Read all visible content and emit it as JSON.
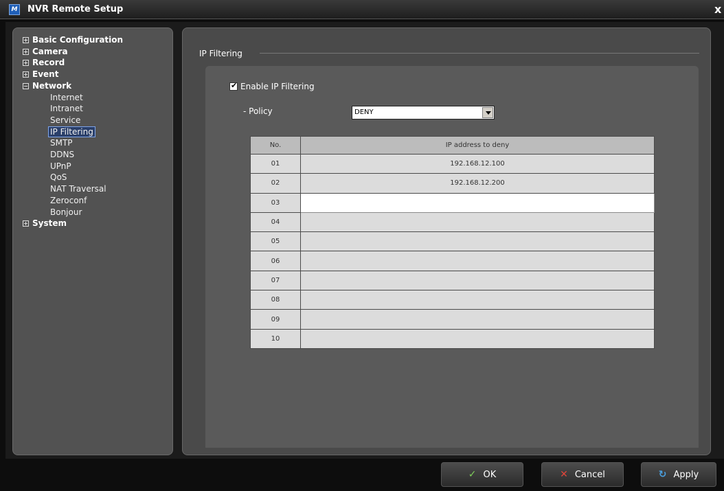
{
  "window": {
    "title": "NVR Remote Setup",
    "icon_label": "M",
    "close_glyph": "x"
  },
  "nav": {
    "top_items": [
      {
        "label": "Basic Configuration",
        "expanded": false
      },
      {
        "label": "Camera",
        "expanded": false
      },
      {
        "label": "Record",
        "expanded": false
      },
      {
        "label": "Event",
        "expanded": false
      },
      {
        "label": "Network",
        "expanded": true
      },
      {
        "label": "System",
        "expanded": false
      }
    ],
    "network_children": [
      "Internet",
      "Intranet",
      "Service",
      "IP Filtering",
      "SMTP",
      "DDNS",
      "UPnP",
      "QoS",
      "NAT Traversal",
      "Zeroconf",
      "Bonjour"
    ],
    "selected": "IP Filtering"
  },
  "section": {
    "title": "IP Filtering"
  },
  "form": {
    "enable_label": "Enable IP Filtering",
    "enable_checked": true,
    "policy_label": "- Policy",
    "policy_value": "DENY"
  },
  "table": {
    "headers": [
      "No.",
      "IP address to deny"
    ],
    "rows": [
      {
        "no": "01",
        "ip": "192.168.12.100"
      },
      {
        "no": "02",
        "ip": "192.168.12.200"
      },
      {
        "no": "03",
        "ip": ""
      },
      {
        "no": "04",
        "ip": ""
      },
      {
        "no": "05",
        "ip": ""
      },
      {
        "no": "06",
        "ip": ""
      },
      {
        "no": "07",
        "ip": ""
      },
      {
        "no": "08",
        "ip": ""
      },
      {
        "no": "09",
        "ip": ""
      },
      {
        "no": "10",
        "ip": ""
      }
    ]
  },
  "buttons": {
    "ok": "OK",
    "cancel": "Cancel",
    "apply": "Apply"
  },
  "colors": {
    "accent_selected": "#7ea4e8",
    "ok_icon": "#7fcf5a",
    "cancel_icon": "#e0453a",
    "apply_icon": "#4aa0e0"
  }
}
